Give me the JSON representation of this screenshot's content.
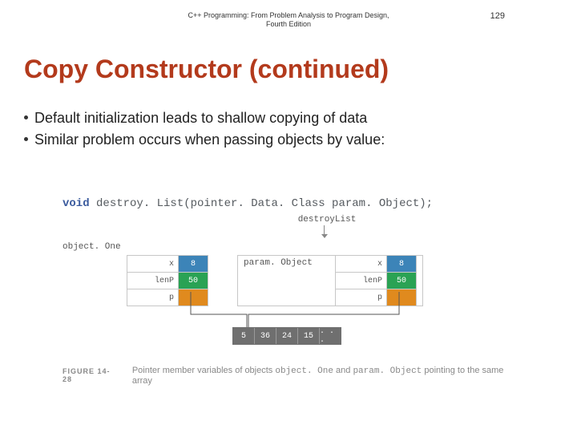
{
  "header": {
    "book_title": "C++ Programming: From Problem Analysis to Program Design, Fourth Edition",
    "page_number": "129"
  },
  "title": "Copy Constructor (continued)",
  "bullets": [
    "Default initialization leads to shallow copying of data",
    "Similar problem occurs when passing objects by value:"
  ],
  "figure": {
    "code_keyword": "void",
    "code_rest": " destroy. List(pointer. Data. Class  param. Object);",
    "destroy_label": "destroyList",
    "object_one_label": "object. One",
    "param_object_label": "param. Object",
    "fields": {
      "x_label": "x",
      "x_value": "8",
      "len_label": "lenP",
      "len_value": "50",
      "p_label": "p",
      "p_value": ""
    },
    "array_cells": [
      "5",
      "36",
      "24",
      "15",
      ". . ."
    ],
    "caption_num": "FIGURE 14-28",
    "caption_text_a": "Pointer member variables of objects ",
    "caption_mono_a": "object. One",
    "caption_text_b": " and ",
    "caption_mono_b": "param. Object",
    "caption_text_c": " pointing to the same array"
  }
}
